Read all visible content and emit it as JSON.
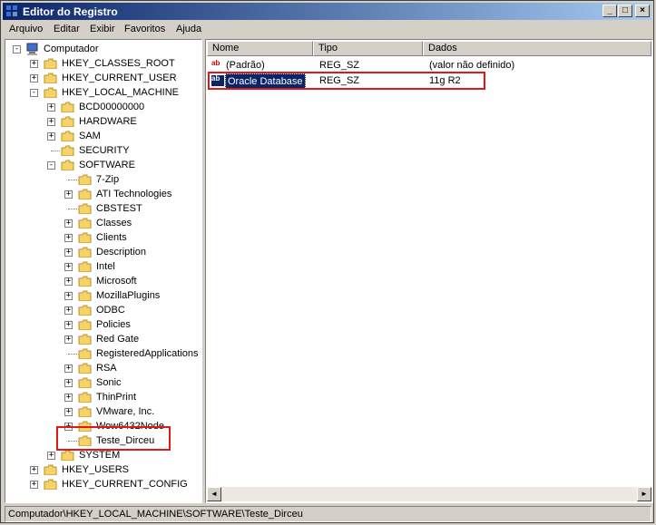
{
  "window": {
    "title": "Editor do Registro"
  },
  "titlebar_buttons": [
    "_",
    "□",
    "×"
  ],
  "menu": [
    "Arquivo",
    "Editar",
    "Exibir",
    "Favoritos",
    "Ajuda"
  ],
  "tree": {
    "root": "Computador",
    "nodes": [
      {
        "label": "HKEY_CLASSES_ROOT",
        "expander": "+"
      },
      {
        "label": "HKEY_CURRENT_USER",
        "expander": "+"
      },
      {
        "label": "HKEY_LOCAL_MACHINE",
        "expander": "-"
      },
      {
        "label": "BCD00000000",
        "expander": "+"
      },
      {
        "label": "HARDWARE",
        "expander": "+"
      },
      {
        "label": "SAM",
        "expander": "+"
      },
      {
        "label": "SECURITY",
        "expander": ""
      },
      {
        "label": "SOFTWARE",
        "expander": "-"
      },
      {
        "label": "7-Zip",
        "expander": ""
      },
      {
        "label": "ATI Technologies",
        "expander": "+"
      },
      {
        "label": "CBSTEST",
        "expander": ""
      },
      {
        "label": "Classes",
        "expander": "+"
      },
      {
        "label": "Clients",
        "expander": "+"
      },
      {
        "label": "Description",
        "expander": "+"
      },
      {
        "label": "Intel",
        "expander": "+"
      },
      {
        "label": "Microsoft",
        "expander": "+"
      },
      {
        "label": "MozillaPlugins",
        "expander": "+"
      },
      {
        "label": "ODBC",
        "expander": "+"
      },
      {
        "label": "Policies",
        "expander": "+"
      },
      {
        "label": "Red Gate",
        "expander": "+"
      },
      {
        "label": "RegisteredApplications",
        "expander": ""
      },
      {
        "label": "RSA",
        "expander": "+"
      },
      {
        "label": "Sonic",
        "expander": "+"
      },
      {
        "label": "ThinPrint",
        "expander": "+"
      },
      {
        "label": "VMware, Inc.",
        "expander": "+"
      },
      {
        "label": "Wow6432Node",
        "expander": "+"
      },
      {
        "label": "Teste_Dirceu",
        "expander": ""
      },
      {
        "label": "SYSTEM",
        "expander": "+"
      },
      {
        "label": "HKEY_USERS",
        "expander": "+"
      },
      {
        "label": "HKEY_CURRENT_CONFIG",
        "expander": "+"
      }
    ]
  },
  "list": {
    "columns": [
      "Nome",
      "Tipo",
      "Dados"
    ],
    "rows": [
      {
        "name": "(Padrão)",
        "type": "REG_SZ",
        "data": "(valor não definido)",
        "icon": "ab"
      },
      {
        "name": "Oracle Database",
        "type": "REG_SZ",
        "data": "11g R2",
        "icon": "ab"
      }
    ]
  },
  "scroll": {
    "left": "◄",
    "right": "►"
  },
  "status": "Computador\\HKEY_LOCAL_MACHINE\\SOFTWARE\\Teste_Dirceu",
  "colors": {
    "highlight": "#0a246a",
    "annotation": "#e01818",
    "title_start": "#0a246a"
  }
}
